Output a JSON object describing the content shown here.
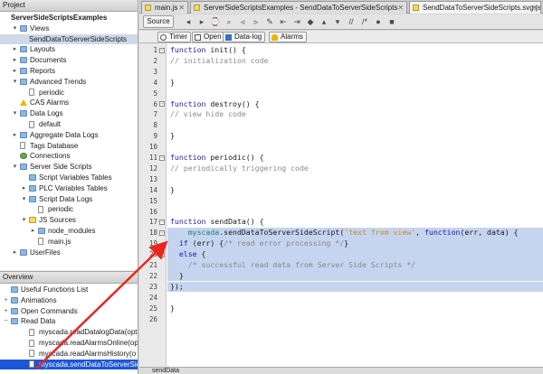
{
  "project_panel": {
    "title": "Project",
    "items": [
      {
        "label": "Project",
        "depth": 0,
        "icon": "none",
        "bold": true,
        "toggle": ""
      },
      {
        "label": "ServerSideScriptsExamples",
        "depth": 0,
        "icon": "none",
        "bold": true,
        "toggle": ""
      },
      {
        "label": "Views",
        "depth": 1,
        "icon": "folder",
        "toggle": "▾"
      },
      {
        "label": "SendDataToServerSideScripts",
        "depth": 2,
        "icon": "none",
        "toggle": "",
        "selected": true
      },
      {
        "label": "Layouts",
        "depth": 1,
        "icon": "folder",
        "toggle": "▸"
      },
      {
        "label": "Documents",
        "depth": 1,
        "icon": "folder",
        "toggle": "▸"
      },
      {
        "label": "Reports",
        "depth": 1,
        "icon": "folder",
        "toggle": "▸"
      },
      {
        "label": "Advanced Trends",
        "depth": 1,
        "icon": "folder",
        "toggle": "▾"
      },
      {
        "label": "periodic",
        "depth": 2,
        "icon": "file",
        "toggle": ""
      },
      {
        "label": "CAS Alarms",
        "depth": 1,
        "icon": "warn",
        "toggle": ""
      },
      {
        "label": "Data Logs",
        "depth": 1,
        "icon": "folder",
        "toggle": "▾"
      },
      {
        "label": "default",
        "depth": 2,
        "icon": "file",
        "toggle": ""
      },
      {
        "label": "Aggregate Data Logs",
        "depth": 1,
        "icon": "folder",
        "toggle": "▸"
      },
      {
        "label": "Tags Database",
        "depth": 1,
        "icon": "file",
        "toggle": ""
      },
      {
        "label": "Connections",
        "depth": 1,
        "icon": "plug",
        "toggle": ""
      },
      {
        "label": "Server Side Scripts",
        "depth": 1,
        "icon": "folder",
        "toggle": "▾"
      },
      {
        "label": "Script Variables Tables",
        "depth": 2,
        "icon": "folder",
        "toggle": ""
      },
      {
        "label": "PLC Variables Tables",
        "depth": 2,
        "icon": "folder",
        "toggle": "▸"
      },
      {
        "label": "Script Data Logs",
        "depth": 2,
        "icon": "folder",
        "toggle": "▾"
      },
      {
        "label": "periodic",
        "depth": 3,
        "icon": "file",
        "toggle": ""
      },
      {
        "label": "JS Sources",
        "depth": 2,
        "icon": "js",
        "toggle": "▾"
      },
      {
        "label": "node_modules",
        "depth": 3,
        "icon": "folder",
        "toggle": "▸"
      },
      {
        "label": "main.js",
        "depth": 3,
        "icon": "file",
        "toggle": ""
      },
      {
        "label": "UserFiles",
        "depth": 1,
        "icon": "folder",
        "toggle": "▸"
      }
    ]
  },
  "overview_panel": {
    "title": "Overview",
    "items": [
      {
        "label": "Useful Functions List",
        "depth": 0,
        "icon": "folder",
        "toggle": ""
      },
      {
        "label": "Animations",
        "depth": 0,
        "icon": "folder",
        "toggle": "+"
      },
      {
        "label": "Open Commands",
        "depth": 0,
        "icon": "folder",
        "toggle": "+"
      },
      {
        "label": "Read Data",
        "depth": 0,
        "icon": "folder",
        "toggle": "−"
      },
      {
        "label": "myscada.readDatalogData(opt",
        "depth": 2,
        "icon": "file",
        "toggle": ""
      },
      {
        "label": "myscada.readAlarmsOnline(op",
        "depth": 2,
        "icon": "file",
        "toggle": ""
      },
      {
        "label": "myscada.readAlarmsHistory(o",
        "depth": 2,
        "icon": "file",
        "toggle": ""
      },
      {
        "label": "myscada.sendDataToServerSic",
        "depth": 2,
        "icon": "file",
        "toggle": "",
        "active": true
      }
    ]
  },
  "tabs": [
    {
      "label": "main.js",
      "close": "✕",
      "active": false
    },
    {
      "label": "ServerSideScriptsExamples - SendDataToServerSideScripts",
      "close": "✕",
      "active": false
    },
    {
      "label": "SendDataToServerSideScripts.svg.js",
      "close": "✕",
      "active": true
    }
  ],
  "toolbar": {
    "source_label": "Source",
    "icons": [
      "back-icon",
      "forward-icon",
      "history-icon",
      "search-icon",
      "find-prev-icon",
      "find-next-icon",
      "toggle-highlight-icon",
      "shift-left-icon",
      "shift-right-icon",
      "bookmark-icon",
      "prev-bookmark-icon",
      "next-bookmark-icon",
      "comment-icon",
      "uncomment-icon",
      "record-macro-icon",
      "stop-macro-icon"
    ]
  },
  "subtoolbar": {
    "timer_label": "Timer",
    "open_label": "Open",
    "datalog_label": "Data-log",
    "alarms_label": "Alarms"
  },
  "editor": {
    "lines": [
      {
        "n": "1",
        "fold": "⊟",
        "html": "<span class='kw'>function</span> init() {"
      },
      {
        "n": "2",
        "fold": "",
        "html": "<span class='cm'>// initialization code</span>"
      },
      {
        "n": "3",
        "fold": "",
        "html": ""
      },
      {
        "n": "4",
        "fold": "",
        "html": "}"
      },
      {
        "n": "5",
        "fold": "",
        "html": ""
      },
      {
        "n": "6",
        "fold": "⊟",
        "html": "<span class='kw'>function</span> destroy() {"
      },
      {
        "n": "7",
        "fold": "",
        "html": "<span class='cm'>// view hide code</span>"
      },
      {
        "n": "8",
        "fold": "",
        "html": ""
      },
      {
        "n": "9",
        "fold": "",
        "html": "}"
      },
      {
        "n": "10",
        "fold": "",
        "html": ""
      },
      {
        "n": "11",
        "fold": "⊟",
        "html": "<span class='kw'>function</span> periodic() {"
      },
      {
        "n": "12",
        "fold": "",
        "html": "<span class='cm'>// periodically triggering code</span>"
      },
      {
        "n": "13",
        "fold": "",
        "html": ""
      },
      {
        "n": "14",
        "fold": "",
        "html": "}"
      },
      {
        "n": "15",
        "fold": "",
        "html": ""
      },
      {
        "n": "16",
        "fold": "",
        "html": ""
      },
      {
        "n": "17",
        "fold": "⊟",
        "html": "<span class='kw'>function</span> sendData() {"
      },
      {
        "n": "18",
        "fold": "⊟",
        "hl": true,
        "html": "    <span class='obj'>myscada</span>.sendDataToServerSideScript(<span class='str'>'text from view'</span>, <span class='kw'>function</span>(err, data) {"
      },
      {
        "n": "19",
        "fold": "",
        "hl": true,
        "html": "  <span class='kw'>if</span> (err) {<span class='cm'>/* read error processing */</span>}"
      },
      {
        "n": "20",
        "fold": "⊟",
        "hl": true,
        "html": "  <span class='kw'>else</span> {"
      },
      {
        "n": "21",
        "fold": "",
        "hl": true,
        "html": "    <span class='cm'>/* successful read data from Server Side Scripts */</span>"
      },
      {
        "n": "22",
        "fold": "",
        "hl": true,
        "html": "  }"
      },
      {
        "n": "23",
        "fold": "",
        "hl": true,
        "html": "});"
      },
      {
        "n": "24",
        "fold": "",
        "html": ""
      },
      {
        "n": "25",
        "fold": "",
        "html": "}"
      },
      {
        "n": "26",
        "fold": "",
        "html": ""
      }
    ]
  },
  "status": {
    "text": "sendData"
  },
  "colors": {
    "highlight": "#c5d4ef",
    "arrow": "#e8271f",
    "selected": "#1d56d6"
  }
}
